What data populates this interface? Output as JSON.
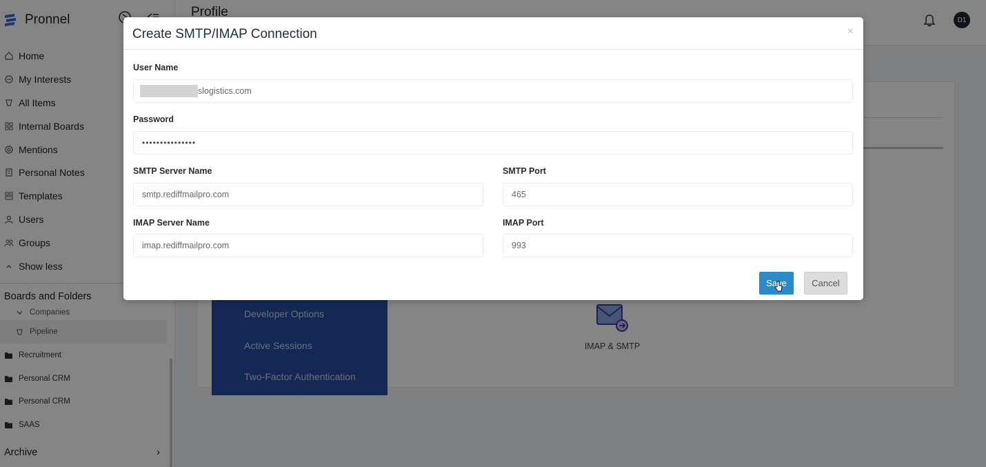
{
  "app": {
    "name": "Pronnel"
  },
  "sidebar": {
    "nav_items": [
      {
        "label": "Home",
        "icon": "home-icon"
      },
      {
        "label": "My Interests",
        "icon": "interests-icon"
      },
      {
        "label": "All Items",
        "icon": "items-icon"
      },
      {
        "label": "Internal Boards",
        "icon": "boards-icon"
      },
      {
        "label": "Mentions",
        "icon": "at-icon"
      },
      {
        "label": "Personal Notes",
        "icon": "notes-icon"
      },
      {
        "label": "Templates",
        "icon": "templates-icon"
      },
      {
        "label": "Users",
        "icon": "user-icon"
      },
      {
        "label": "Groups",
        "icon": "groups-icon"
      },
      {
        "label": "Show less",
        "icon": "chevron-up-icon"
      }
    ],
    "boards_header": "Boards and Folders",
    "folders": [
      {
        "label": "Companies",
        "type": "sub"
      },
      {
        "label": "Pipeline",
        "type": "sub-highlight"
      },
      {
        "label": "Recruitment",
        "type": "folder"
      },
      {
        "label": "Personal CRM",
        "type": "folder"
      },
      {
        "label": "Personal CRM",
        "type": "folder"
      },
      {
        "label": "SAAS",
        "type": "folder"
      }
    ],
    "archive_label": "Archive",
    "archive_chevron": "›"
  },
  "header": {
    "title": "Profile",
    "avatar_initials": "D1"
  },
  "main": {
    "settings_menu": [
      "Developer Options",
      "Active Sessions",
      "Two-Factor Authentication"
    ],
    "imap_tile_label": "IMAP & SMTP"
  },
  "modal": {
    "title": "Create SMTP/IMAP Connection",
    "close": "×",
    "username_label": "User Name",
    "username_value_visible": "slogistics.com",
    "password_label": "Password",
    "password_value": "•••••••••••••••",
    "smtp_server_label": "SMTP Server Name",
    "smtp_server_value": "smtp.rediffmailpro.com",
    "smtp_port_label": "SMTP Port",
    "smtp_port_value": "465",
    "imap_server_label": "IMAP Server Name",
    "imap_server_value": "imap.rediffmailpro.com",
    "imap_port_label": "IMAP Port",
    "imap_port_value": "993",
    "save_label": "Save",
    "cancel_label": "Cancel"
  },
  "colors": {
    "accent": "#2b8ac9",
    "menu_blue": "#2a4da3",
    "backdrop": "rgba(0,0,0,0.48)"
  }
}
